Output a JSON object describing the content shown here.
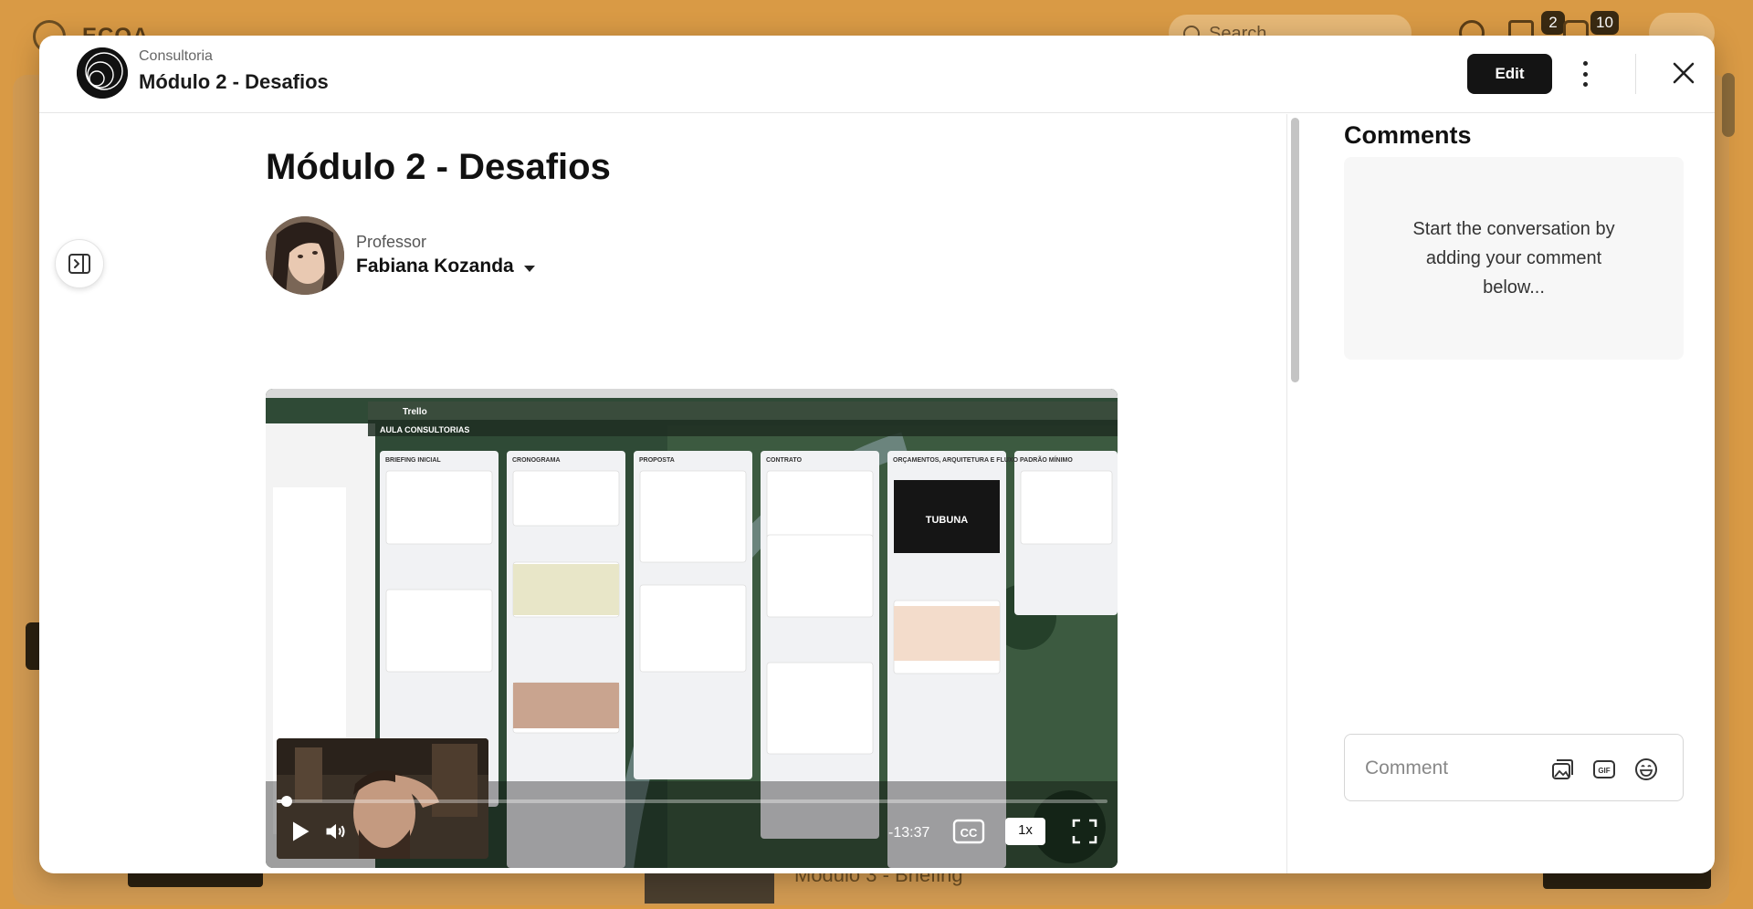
{
  "background_app": {
    "brand": "ECOA",
    "search_placeholder": "Search",
    "notifications_count": "2",
    "messages_count": "10",
    "next_module_label": "Módulo 3 - Briefing"
  },
  "header": {
    "course_label": "Consultoria",
    "lesson_title": "Módulo 2 - Desafios",
    "edit_label": "Edit"
  },
  "lesson": {
    "title": "Módulo 2 - Desafios",
    "instructor_role": "Professor",
    "instructor_name": "Fabiana Kozanda"
  },
  "video": {
    "time_remaining": "-13:37",
    "speed": "1x",
    "progress": 0.008,
    "board_title": "AULA CONSULTORIAS",
    "columns": [
      "BRIEFING INICIAL",
      "CRONOGRAMA",
      "PROPOSTA",
      "CONTRATO",
      "ORÇAMENTOS, ARQUITETURA E FLUXO",
      "PADRÃO MÍNIMO"
    ],
    "app_name": "Trello"
  },
  "comments": {
    "title": "Comments",
    "empty_text": "Start the conversation by adding your comment below...",
    "input_placeholder": "Comment"
  },
  "colors": {
    "backdrop": "#c88a3e",
    "button_dark": "#141414",
    "video_bg": "#2e3a2e"
  },
  "icons": {
    "panel_toggle": "sidebar-toggle-icon",
    "kebab": "more-vertical-icon",
    "close": "close-icon",
    "play": "play-icon",
    "volume": "volume-icon",
    "captions": "closed-captions-icon",
    "fullscreen": "fullscreen-icon",
    "image_upload": "image-icon",
    "gif": "gif-icon",
    "emoji": "emoji-icon"
  }
}
